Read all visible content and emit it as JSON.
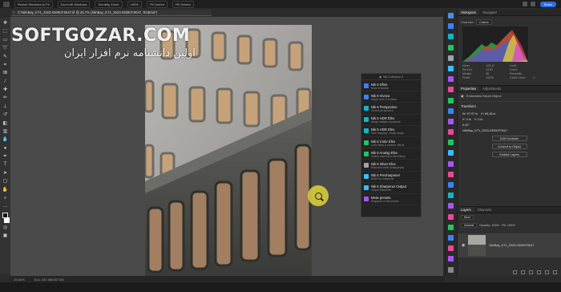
{
  "options_bar": {
    "items": [
      "Resize Windows to Fit",
      "Zoom All Windows",
      "Scrubby Zoom",
      "100%",
      "Fit Screen",
      "Fill Screen"
    ],
    "share_label": "Share"
  },
  "document": {
    "tab_title": "C:\\Nik\\Bay_KT1_2023-0309CF0047.tif @ 25.7% (Nik\\Bay_KT1_2023-0309CF0047, RGB/16*)"
  },
  "watermark": {
    "latin": "SOFTGOZAR.COM",
    "persian": "اولین دانشنامه نرم افزار ایران"
  },
  "nik_panel": {
    "header": "Nik Collection 6",
    "items": [
      {
        "name": "Nik 6 Dfine",
        "desc": "Noise reduction",
        "color": "#3b82f6"
      },
      {
        "name": "Nik 6 Viveza",
        "desc": "Adjust color & contrast",
        "color": "#3b82f6"
      },
      {
        "name": "Nik 6 Perspective",
        "desc": "Correct perspective",
        "color": "#10b6c9"
      },
      {
        "name": "Nik 6 HDR Efex",
        "desc": "Merge multiple exposures",
        "color": "#10b6c9"
      },
      {
        "name": "Nik 6 HDR Efex",
        "desc": "Tone mapping - single image",
        "color": "#10b6c9"
      },
      {
        "name": "Nik 6 Color Efex",
        "desc": "Color filters & creative effects",
        "color": "#22c55e"
      },
      {
        "name": "Nik 6 Analog Efex",
        "desc": "Classic cameras & film effects",
        "color": "#22c55e"
      },
      {
        "name": "Nik 6 Silver Efex",
        "desc": "Black and white photography",
        "color": "#9ca3af"
      },
      {
        "name": "Nik 6 Presharpener",
        "desc": "RAW Pre-sharpener",
        "color": "#38bdf8"
      },
      {
        "name": "Nik 6 Sharpener Output",
        "desc": "Output Sharpener",
        "color": "#38bdf8"
      },
      {
        "name": "Meta-presets",
        "desc": "Sequence of Nik presets",
        "color": "#a855f7"
      }
    ]
  },
  "histogram_panel": {
    "tabs": [
      "Histogram",
      "Navigator"
    ],
    "channel_label": "Channel:",
    "channel_value": "Colors",
    "stats": [
      "Mean:",
      "105.12",
      "Level:",
      "",
      "Std Dev:",
      "53.83",
      "Count:",
      "",
      "Median:",
      "88",
      "Percentile:",
      "",
      "Pixels:",
      "26229",
      "Cache Level:",
      "4"
    ]
  },
  "properties_panel": {
    "tabs": [
      "Properties",
      "Adjustments"
    ],
    "object_label": "Embedded Smart Object",
    "transform_label": "Transform",
    "w": "W: 97.97 in",
    "h": "H: 65.48 in",
    "x": "X: 0 in",
    "y": "Y: 0 in",
    "angle": "0.00°",
    "file_name": "Nik\\Bay_KT1_2023-0309CF0047",
    "buttons": [
      "Edit Contents",
      "Convert to Object",
      "Embed Layers"
    ]
  },
  "layers_panel": {
    "tabs": [
      "Layers",
      "Channels"
    ],
    "kind_label": "Kind",
    "blend_mode": "Normal",
    "opacity_label": "Opacity: 100%",
    "fill_label": "Fill: 100%",
    "layer_name": "Nik\\Bay_KT1_2023-0309CF0047"
  },
  "status_bar": {
    "zoom": "25.68%",
    "doc_info": "Doc: 287.0M/287.0M"
  }
}
